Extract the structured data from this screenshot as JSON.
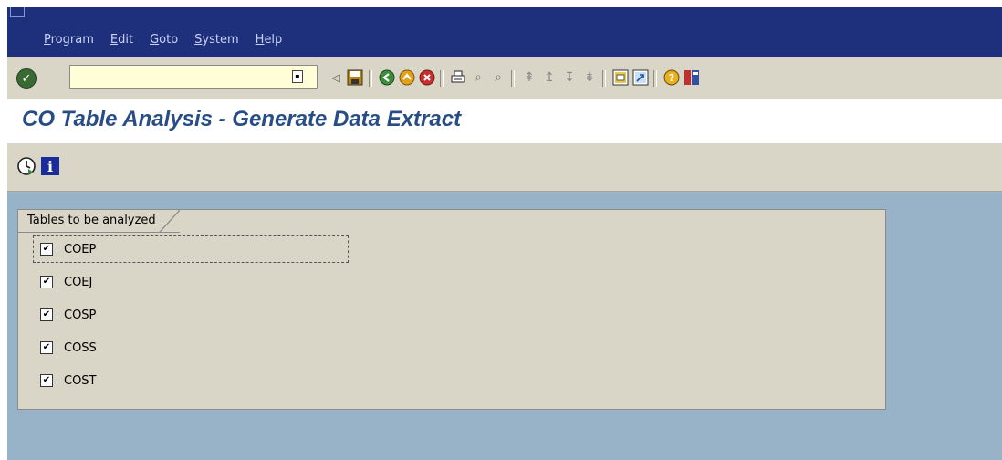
{
  "menu": {
    "items": [
      {
        "label": "Program",
        "underline": "P"
      },
      {
        "label": "Edit",
        "underline": "E"
      },
      {
        "label": "Goto",
        "underline": "G"
      },
      {
        "label": "System",
        "underline": "S"
      },
      {
        "label": "Help",
        "underline": "H"
      }
    ]
  },
  "toolbar": {
    "command_value": "",
    "icons": [
      "enter-icon",
      "command-field-dropdown-icon",
      "back-arrow-icon",
      "save-icon",
      "back-icon",
      "exit-icon",
      "cancel-icon",
      "print-icon",
      "find-icon",
      "find-next-icon",
      "first-page-icon",
      "previous-page-icon",
      "next-page-icon",
      "last-page-icon",
      "create-session-icon",
      "shortcut-icon",
      "help-icon",
      "customize-layout-icon"
    ]
  },
  "title": "CO Table Analysis - Generate Data Extract",
  "app_toolbar": {
    "icons": [
      "execute-icon",
      "info-icon"
    ]
  },
  "group": {
    "title": "Tables to be analyzed",
    "items": [
      {
        "label": "COEP",
        "checked": true
      },
      {
        "label": "COEJ",
        "checked": true
      },
      {
        "label": "COSP",
        "checked": true
      },
      {
        "label": "COSS",
        "checked": true
      },
      {
        "label": "COST",
        "checked": true
      }
    ]
  },
  "colors": {
    "menubar": "#1e2f7b",
    "title_text": "#284c86",
    "toolbar": "#d9d6c7",
    "background": "#98b3c8"
  }
}
